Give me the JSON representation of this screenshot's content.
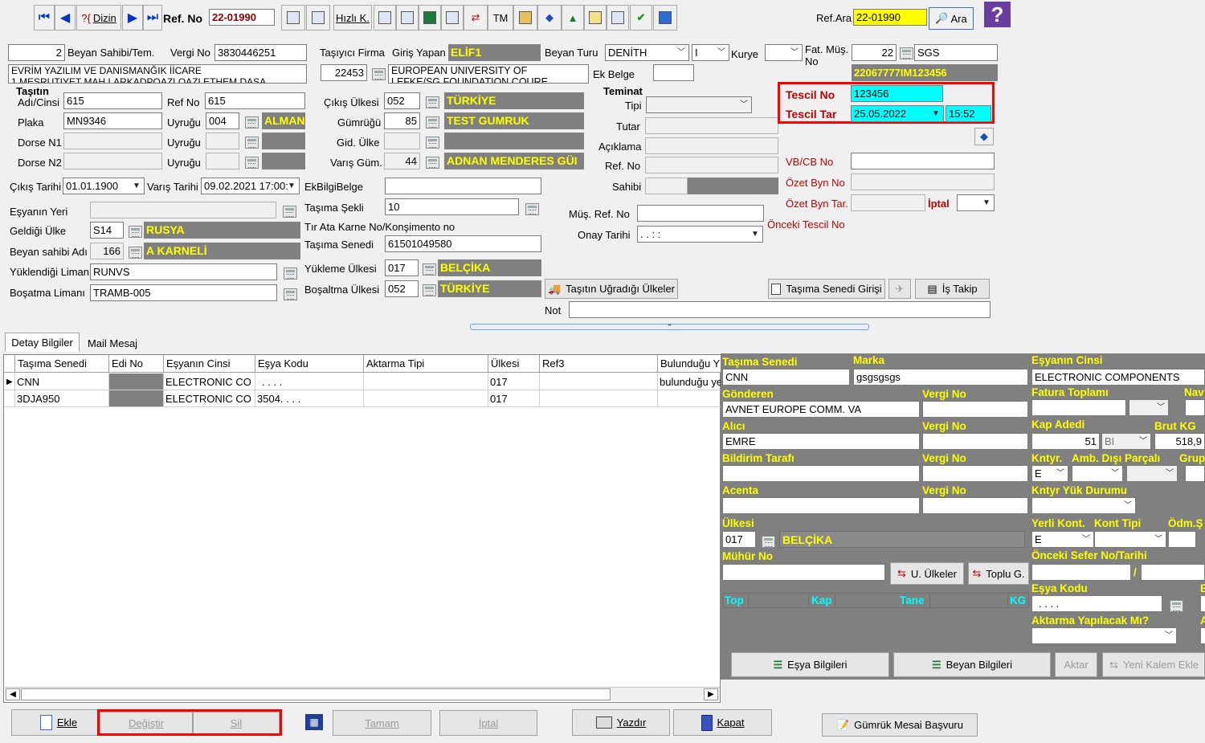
{
  "toolbar": {
    "dizin": "Dizin",
    "ref_no_label": "Ref. No",
    "ref_no_value": "22-01990",
    "hizli": "Hızlı K.",
    "tm": "TM",
    "ref_ara_label": "Ref.Ara",
    "ref_ara_value": "22-01990",
    "ara": "Ara",
    "help": "?"
  },
  "header": {
    "beyan_sahibi_no": "2",
    "beyan_sahibi_label": "Beyan Sahibi/Tem.",
    "vergi_no_label": "Vergi No",
    "vergi_no": "3830446251",
    "firma_text": "EVRİM YAZILIM VE DANISMANĞIK İİCARE",
    "firma_text2": "1 MESRUTIYET MAH.LARKADPOAZLOAZLETHEM DASA",
    "tasiyici_label": "Taşıyıcı Firma",
    "giris_yapan_label": "Giriş Yapan",
    "giris_yapan": "ELİF1",
    "beyan_turu_label": "Beyan Turu",
    "beyan_turu": "DENİTH",
    "beyan_turu2": "I",
    "kurye_label": "Kurye",
    "fat_mus_label": "Fat. Müş. No",
    "fat_mus_no": "22",
    "fat_mus_name": "SGS",
    "fat_mus_code": "22067777IM123456",
    "tasiyici_no": "22453",
    "tasiyici_name": "EUROPEAN UNIVERSITY OF",
    "tasiyici_name2": "LEFKE/SG FOUNDATION COURE",
    "ek_belge_label": "Ek Belge",
    "tasitin_label": "Taşıtın",
    "adi_cinsi_label": "Adı/Cinsi",
    "adi_cinsi": "615",
    "ref_no_label": "Ref No",
    "ref_no": "615",
    "plaka_label": "Plaka",
    "plaka": "MN9346",
    "uyrugu_label": "Uyruğu",
    "uyrugu": "004",
    "uyrugu_name": "ALMAN",
    "dorse1_label": "Dorse N1",
    "dorse2_label": "Dorse N2",
    "cikis_ulkesi_label": "Çıkış Ülkesi",
    "cikis_ulkesi": "052",
    "cikis_ulkesi_name": "TÜRKİYE",
    "gumrugu_label": "Gümrüğü",
    "gumrugu": "85",
    "gumrugu_name": "TEST GUMRUK",
    "gid_ulke_label": "Gid. Ülke",
    "varis_gum_label": "Varış Güm.",
    "varis_gum": "44",
    "varis_gum_name": "ADNAN MENDERES GÜI",
    "teminat_label": "Teminat",
    "tipi_label": "Tipi",
    "tutar_label": "Tutar",
    "aciklama_label": "Açıklama",
    "t_ref_no_label": "Ref. No",
    "sahibi_label": "Sahibi",
    "tescil_no_label": "Tescil No",
    "tescil_no": "123456",
    "tescil_tar_label": "Tescil Tar",
    "tescil_tar": "25.05.2022",
    "tescil_saat": "15:52",
    "vbcb_label": "VB/CB No",
    "ozet_byn_label": "Özet Byn No",
    "ozet_byn_tar_label": "Özet Byn Tar.",
    "iptal_label": "İptal",
    "onceki_tescil_label": "Önceki Tescil No",
    "cikis_tarihi_label": "Çıkış Tarihi",
    "cikis_tarihi": "01.01.1900",
    "varis_tarihi_label": "Varış Tarihi",
    "varis_tarihi": "09.02.2021 17:00:",
    "ekbilgi_label": "EkBilgiBelge",
    "esyanin_yeri_label": "Eşyanın Yeri",
    "tasima_sekli_label": "Taşıma Şekli",
    "tasima_sekli": "10",
    "mus_ref_label": "Müş. Ref. No",
    "onay_tarihi_label": "Onay Tarihi",
    "onay_tarihi": ". .   : :",
    "geldigi_ulke_label": "Geldiği Ülke",
    "geldigi_ulke": "S14",
    "geldigi_ulke_name": "RUSYA",
    "tir_ata_label": "Tır Ata Karne No/Konşimento no",
    "beyan_sahibi_adi_label": "Beyan sahibi Adı",
    "beyan_sahibi_adi": "166",
    "beyan_sahibi_adi_name": "A KARNELİ",
    "tasima_senedi_label": "Taşıma Senedi",
    "tasima_senedi": "61501049580",
    "yuklendigi_liman_label": "Yüklendiği Liman",
    "yuklendigi_liman": "RUNVS",
    "yukleme_ulkesi_label": "Yükleme Ülkesi",
    "yukleme_ulkesi": "017",
    "yukleme_ulkesi_name": "BELÇİKA",
    "bosaltma_limani_label": "Boşatma Limanı",
    "bosaltma_limani": "TRAMB-005",
    "bosaltma_ulkesi_label": "Boşaltma Ülkesi",
    "bosaltma_ulkesi": "052",
    "bosaltma_ulkesi_name": "TÜRKİYE",
    "ugradigi_ulkeler": "Taşıtın Uğradığı Ülkeler",
    "tasima_senedi_girisi": "Taşıma Senedi Girişi",
    "is_takip": "İş Takip",
    "not_label": "Not"
  },
  "tabs": [
    "Detay Bilgiler",
    "Mail Mesaj"
  ],
  "grid": {
    "columns": [
      "Taşıma Senedi",
      "Edi No",
      "Eşyanın Cinsi",
      "Eşya Kodu",
      "Aktarma Tipi",
      "Ülkesi",
      "Ref3",
      "Bulunduğu Y"
    ],
    "rows": [
      [
        "CNN",
        "",
        "ELECTRONIC CO",
        ". . . .",
        "",
        "017",
        "",
        "bulunduğu ye"
      ],
      [
        "3DJA950",
        "",
        "ELECTRONIC CO",
        "3504. . . .",
        "",
        "017",
        "",
        ""
      ]
    ]
  },
  "detail": {
    "tasima_senedi_label": "Taşıma Senedi",
    "tasima_senedi": "CNN",
    "marka_label": "Marka",
    "marka": "gsgsgsgs",
    "esyanin_cinsi_label": "Eşyanın Cinsi",
    "esyanin_cinsi": "ELECTRONIC COMPONENTS",
    "gonderen_label": "Gönderen",
    "gonderen": "AVNET EUROPE COMM. VA",
    "vergi_no_label": "Vergi No",
    "fatura_toplami_label": "Fatura Toplamı",
    "nav_label": "Nav",
    "alici_label": "Alıcı",
    "alici": "EMRE",
    "kap_adedi_label": "Kap Adedi",
    "kap_adedi": "51",
    "kap_birim": "BI",
    "brut_kg_label": "Brut KG",
    "brut_kg": "518,9",
    "bildirim_label": "Bildirim Tarafı",
    "kntyr_label": "Kntyr.",
    "kntyr": "E",
    "amb_label": "Amb. Dışı Parçalı",
    "grup_label": "Grup",
    "acenta_label": "Acenta",
    "kntyr_yuk_label": "Kntyr Yük Durumu",
    "ulkesi_label": "Ülkesi",
    "ulkesi": "017",
    "ulkesi_name": "BELÇİKA",
    "yerli_kont_label": "Yerli Kont.",
    "yerli_kont": "E",
    "kont_tipi_label": "Kont Tipi",
    "odm_label": "Ödm.Ş",
    "muhur_label": "Mühür No",
    "u_ulkeler": "U. Ülkeler",
    "toplu_g": "Toplu G.",
    "onceki_sefer_label": "Önceki Sefer No/Tarihi",
    "slash": "/",
    "top_label": "Top",
    "kap_label": "Kap",
    "tane_label": "Tane",
    "kg_label": "KG",
    "esya_kodu_label": "Eşya Kodu",
    "esya_kodu": ". . . .",
    "aktarma_label": "Aktarma Yapılacak Mı?",
    "esya_bilgileri": "Eşya Bilgileri",
    "beyan_bilgileri": "Beyan Bilgileri",
    "aktar": "Aktar",
    "yeni_kalem": "Yeni Kalem Ekle"
  },
  "bottom": {
    "ekle": "Ekle",
    "degistir": "Değiştir",
    "sil": "Sil",
    "tamam": "Tamam",
    "iptal": "İptal",
    "yazdir": "Yazdır",
    "kapat": "Kapat",
    "gumruk_mesaj": "Gümrük Mesai Başvuru"
  },
  "colors": {
    "highlight_red": "#ff0000",
    "label_yellow": "#ffff00",
    "field_cyan": "#00ffff",
    "panel_gray": "#808080"
  }
}
